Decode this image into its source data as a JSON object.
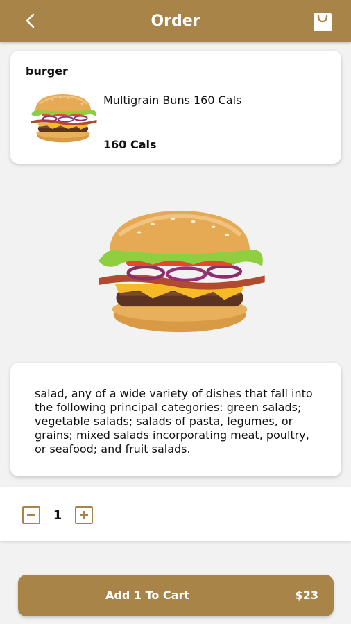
{
  "header": {
    "title": "Order",
    "back_icon": "chevron-left-icon",
    "bag_icon": "shopping-bag-icon",
    "color": "#a98449"
  },
  "item": {
    "category": "burger",
    "name": "Multigrain Buns 160 Cals",
    "calories": "160 Cals"
  },
  "description": "salad, any of a wide variety of dishes that fall into the following principal categories: green salads; vegetable salads; salads of pasta, legumes, or grains; mixed salads incorporating meat, poultry, or seafood; and fruit salads.",
  "quantity": {
    "value": "1",
    "decrease_icon": "minus-icon",
    "increase_icon": "plus-icon"
  },
  "cart": {
    "label": "Add 1 To Cart",
    "price": "$23"
  }
}
